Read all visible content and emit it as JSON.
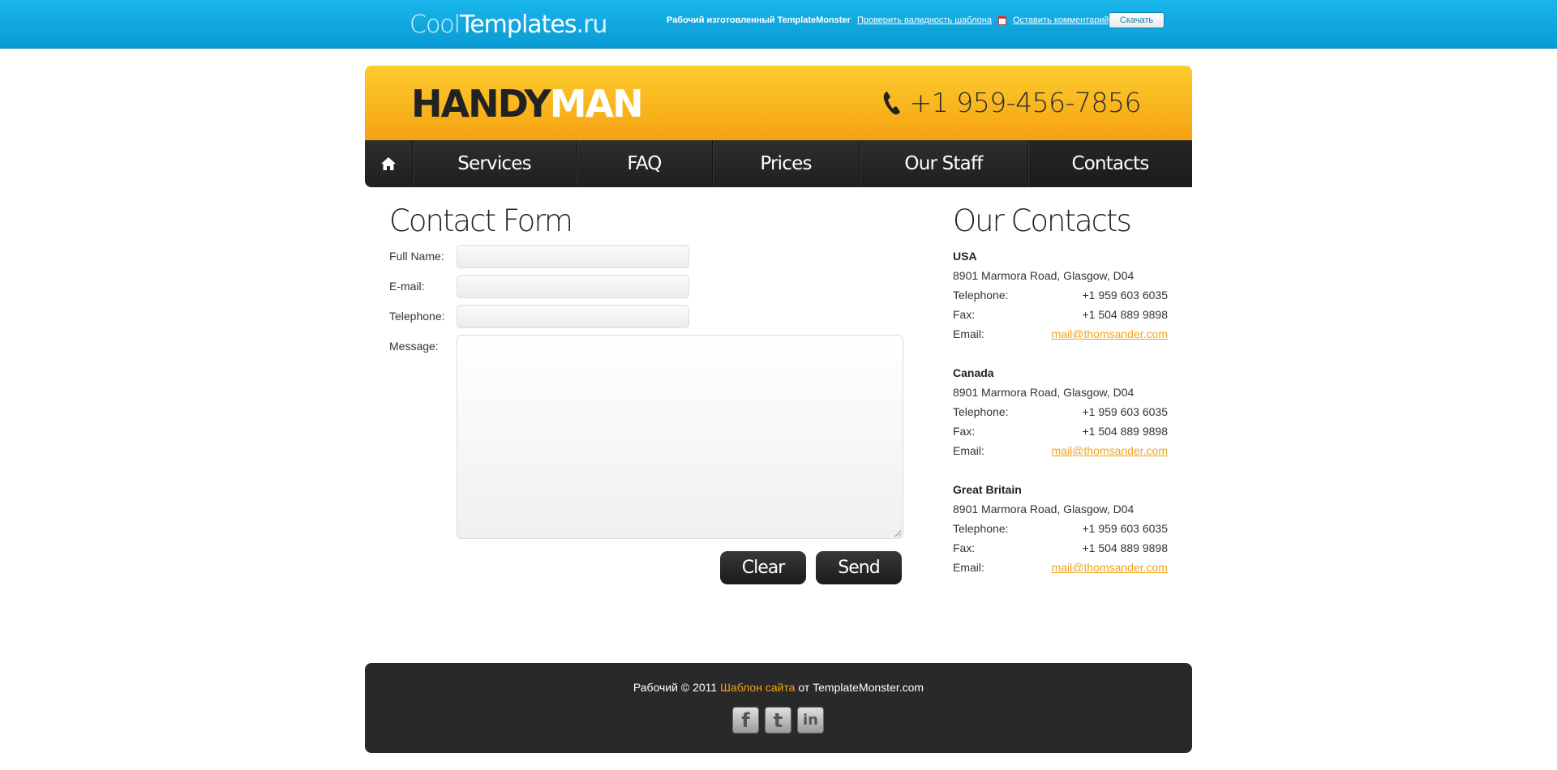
{
  "topbar": {
    "logo_part1": "Cool",
    "logo_part2": "Templates",
    "logo_part3": ".ru",
    "made_by": "Рабочий изготовленный TemplateMonster",
    "validate_link": "Проверить валидность шаблона",
    "comment_link": "Оставить комментарий",
    "download_button": "Скачать"
  },
  "header": {
    "brand_dark": "HANDY",
    "brand_light": "MAN",
    "phone": "+1 959-456-7856",
    "colors": {
      "header_top": "#fccc2e",
      "header_bottom": "#f6a212",
      "accent": "#f3a31a"
    }
  },
  "nav": {
    "home_icon": "home-icon",
    "items": [
      {
        "label": "Services"
      },
      {
        "label": "FAQ"
      },
      {
        "label": "Prices"
      },
      {
        "label": "Our Staff"
      },
      {
        "label": "Contacts",
        "active": true
      }
    ]
  },
  "contact_form": {
    "title": "Contact Form",
    "fields": [
      {
        "label": "Full Name:",
        "value": ""
      },
      {
        "label": "E-mail:",
        "value": ""
      },
      {
        "label": "Telephone:",
        "value": ""
      },
      {
        "label": "Message:",
        "value": ""
      }
    ],
    "clear_button": "Clear",
    "send_button": "Send"
  },
  "our_contacts": {
    "title": "Our Contacts",
    "offices": [
      {
        "country": "USA",
        "address": "8901 Marmora Road, Glasgow, D04",
        "telephone_label": "Telephone:",
        "telephone": "+1 959 603 6035",
        "fax_label": "Fax:",
        "fax": "+1 504 889 9898",
        "email_label": "Email:",
        "email": "mail@thomsander.com"
      },
      {
        "country": "Canada",
        "address": "8901 Marmora Road, Glasgow, D04",
        "telephone_label": "Telephone:",
        "telephone": "+1 959 603 6035",
        "fax_label": "Fax:",
        "fax": "+1 504 889 9898",
        "email_label": "Email:",
        "email": "mail@thomsander.com"
      },
      {
        "country": "Great Britain",
        "address": "8901 Marmora Road, Glasgow, D04",
        "telephone_label": "Telephone:",
        "telephone": "+1 959 603 6035",
        "fax_label": "Fax:",
        "fax": "+1 504 889 9898",
        "email_label": "Email:",
        "email": "mail@thomsander.com"
      }
    ]
  },
  "footer": {
    "copy_prefix": "Рабочий © 2011",
    "copy_link": "Шаблон сайта",
    "copy_suffix": "от TemplateMonster.com",
    "social_icons": [
      "facebook-icon",
      "twitter-icon",
      "linkedin-icon"
    ],
    "social_glyphs": [
      "f",
      "t",
      "in"
    ]
  }
}
